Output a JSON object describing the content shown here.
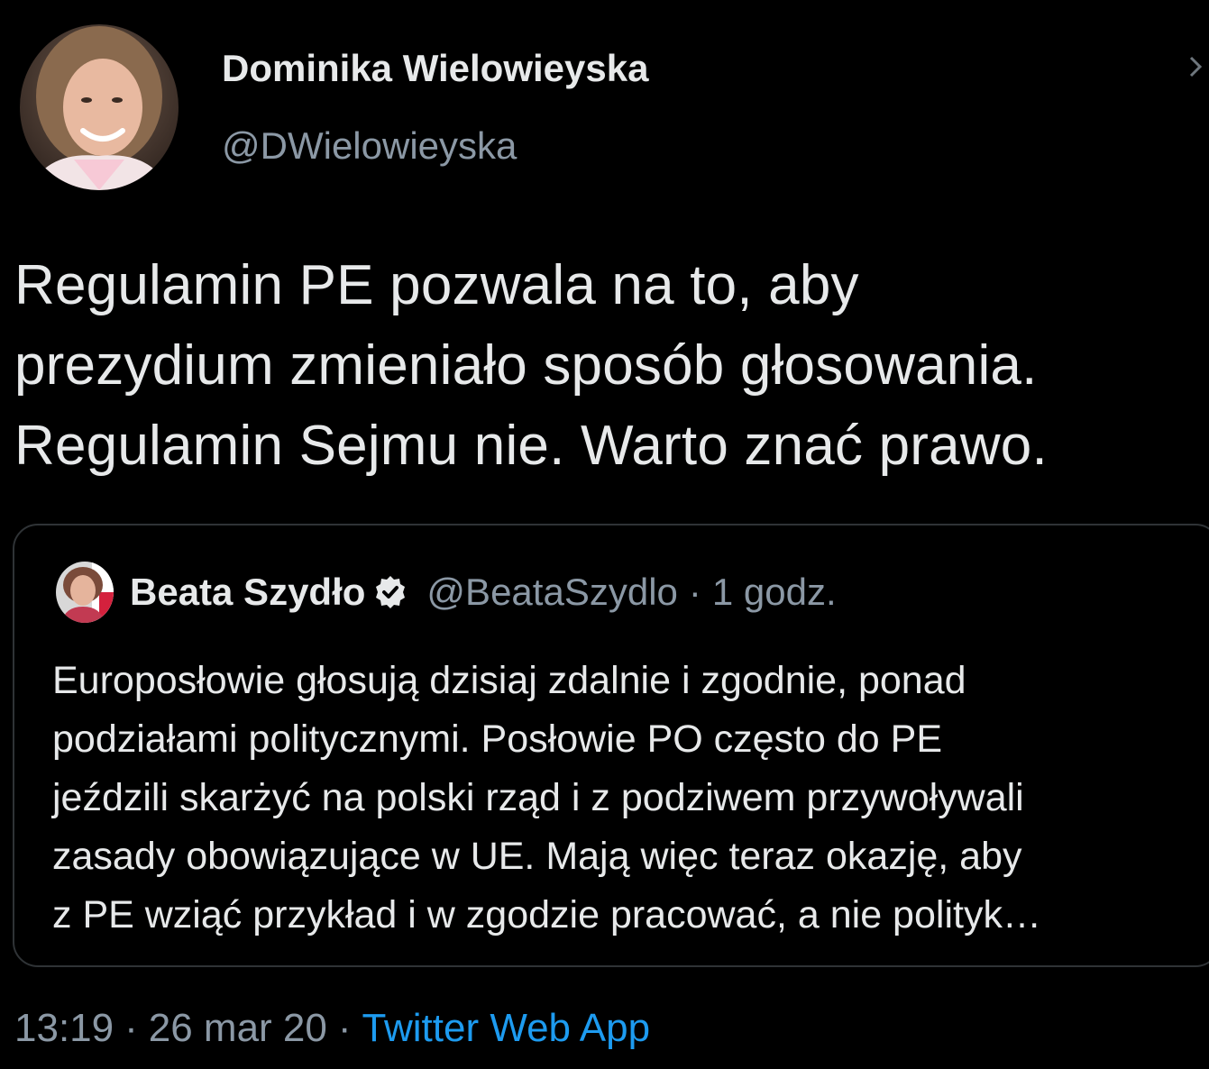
{
  "author": {
    "name": "Dominika Wielowieyska",
    "handle": "@DWielowieyska"
  },
  "tweet": {
    "lines": [
      "Regulamin PE pozwala na to, aby",
      "prezydium zmieniało sposób głosowania.",
      "Regulamin Sejmu nie. Warto znać prawo."
    ]
  },
  "quoted": {
    "name": "Beata Szydło",
    "verified_icon": "verified-badge-icon",
    "handle": "@BeataSzydlo",
    "separator": "·",
    "time": "1 godz.",
    "lines": [
      "Europosłowie głosują dzisiaj zdalnie i zgodnie, ponad",
      "podziałami politycznymi.  Posłowie PO często do PE",
      "jeździli skarżyć na polski rząd i z podziwem przywoływali",
      "zasady obowiązujące w UE.  Mają więc teraz okazję, aby",
      "z PE wziąć przykład i w zgodzie pracować, a nie polityk…"
    ]
  },
  "footer": {
    "time": "13:19",
    "separator": "·",
    "date": "26 mar 20",
    "source": "Twitter Web App"
  },
  "colors": {
    "background": "#000000",
    "text": "#e7e9ea",
    "secondary": "#8b98a5",
    "link": "#1d9bf0",
    "border": "#2f3336"
  },
  "icons": {
    "more": "more-vertical-icon",
    "avatar_main": "avatar-photo",
    "avatar_quote": "avatar-photo"
  }
}
